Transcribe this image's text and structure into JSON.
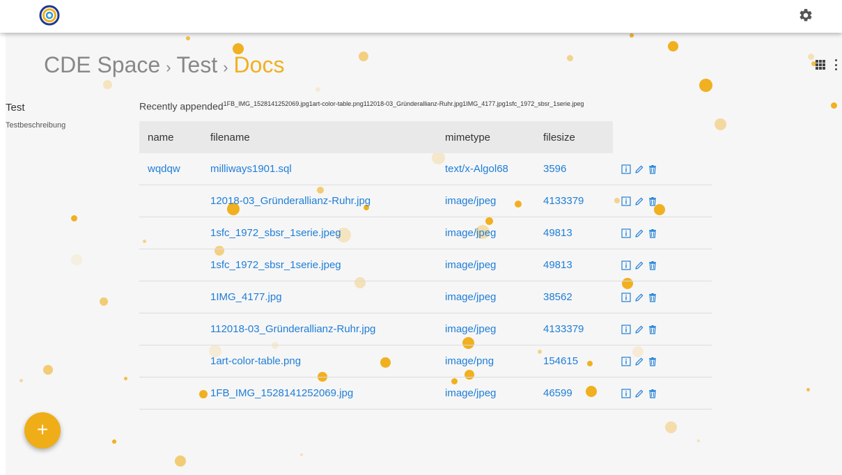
{
  "breadcrumb": {
    "items": [
      "CDE Space",
      "Test"
    ],
    "current": "Docs",
    "separator": "›"
  },
  "sidebar": {
    "title": "Test",
    "description": "Testbeschreibung"
  },
  "recent": {
    "label": "Recently appended",
    "files": "1FB_IMG_1528141252069.jpg1art-color-table.png112018-03_Gründerallianz-Ruhr.jpg1IMG_4177.jpg1sfc_1972_sbsr_1serie.jpeg"
  },
  "table": {
    "headers": [
      "name",
      "filename",
      "mimetype",
      "filesize"
    ],
    "rows": [
      {
        "name": "wqdqw",
        "filename": "milliways1901.sql",
        "mimetype": "text/x-Algol68",
        "filesize": "3596"
      },
      {
        "name": "",
        "filename": "12018-03_Gründerallianz-Ruhr.jpg",
        "mimetype": "image/jpeg",
        "filesize": "4133379"
      },
      {
        "name": "",
        "filename": "1sfc_1972_sbsr_1serie.jpeg",
        "mimetype": "image/jpeg",
        "filesize": "49813"
      },
      {
        "name": "",
        "filename": "1sfc_1972_sbsr_1serie.jpeg",
        "mimetype": "image/jpeg",
        "filesize": "49813"
      },
      {
        "name": "",
        "filename": "1IMG_4177.jpg",
        "mimetype": "image/jpeg",
        "filesize": "38562"
      },
      {
        "name": "",
        "filename": "112018-03_Gründerallianz-Ruhr.jpg",
        "mimetype": "image/jpeg",
        "filesize": "4133379"
      },
      {
        "name": "",
        "filename": "1art-color-table.png",
        "mimetype": "image/png",
        "filesize": "154615"
      },
      {
        "name": "",
        "filename": "1FB_IMG_1528141252069.jpg",
        "mimetype": "image/jpeg",
        "filesize": "46599"
      }
    ],
    "row_actions": [
      "info-icon",
      "edit-icon",
      "delete-icon"
    ]
  },
  "fab": {
    "label": "+",
    "icon": "plus-icon"
  },
  "icons": {
    "logo": "logo-icon",
    "settings": "gear-icon",
    "view": "grid-view-icon",
    "menu": "more-vert-icon"
  },
  "colors": {
    "accent": "#f0b020",
    "link": "#1e7ed8",
    "fab": "#efad18",
    "header_bg": "#e9e9e9",
    "background": "#f6f6f6"
  }
}
